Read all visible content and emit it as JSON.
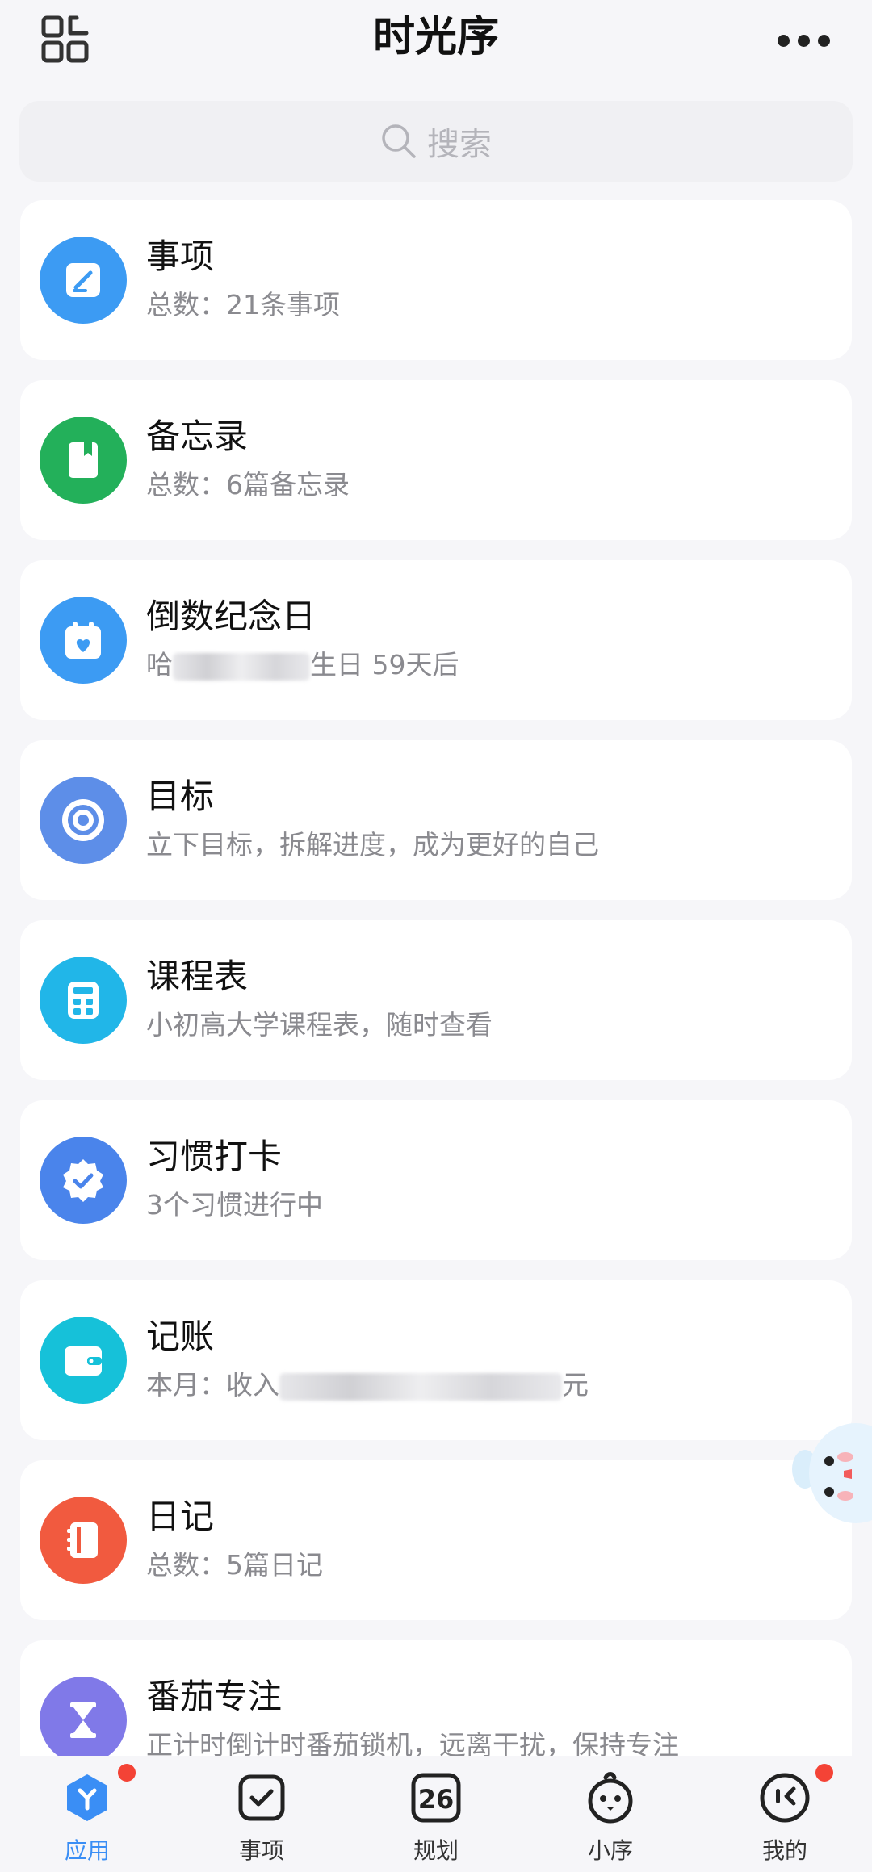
{
  "header": {
    "title": "时光序",
    "scan_icon": "scan-icon",
    "more_icon": "more-icon"
  },
  "search": {
    "placeholder": "搜索"
  },
  "items": [
    {
      "name": "事项",
      "sub": "总数：21条事项",
      "color": "#3c9bf3",
      "icon": "edit-icon"
    },
    {
      "name": "备忘录",
      "sub": "总数：6篇备忘录",
      "color": "#23b05a",
      "icon": "notebook-icon"
    },
    {
      "name": "倒数纪念日",
      "sub_prefix": "哈",
      "sub_suffix": "生日 59天后",
      "color": "#3c9bf3",
      "icon": "calendar-heart-icon"
    },
    {
      "name": "目标",
      "sub": "立下目标，拆解进度，成为更好的自己",
      "color": "#5d8ee8",
      "icon": "target-icon"
    },
    {
      "name": "课程表",
      "sub": "小初高大学课程表，随时查看",
      "color": "#21b6e8",
      "icon": "calculator-icon"
    },
    {
      "name": "习惯打卡",
      "sub": "3个习惯进行中",
      "color": "#4a84eb",
      "icon": "badge-check-icon"
    },
    {
      "name": "记账",
      "sub_prefix": "本月：收入",
      "sub_suffix": "元",
      "color": "#16c1d9",
      "icon": "wallet-icon"
    },
    {
      "name": "日记",
      "sub": "总数：5篇日记",
      "color": "#f15a3f",
      "icon": "diary-icon"
    },
    {
      "name": "番茄专注",
      "sub": "正计时倒计时番茄锁机，远离干扰，保持专注",
      "color": "#8079e8",
      "icon": "hourglass-icon"
    }
  ],
  "tabs": [
    {
      "label": "应用",
      "icon": "apps-icon",
      "active": true,
      "badge": true
    },
    {
      "label": "事项",
      "icon": "check-square-icon",
      "active": false,
      "badge": false
    },
    {
      "label": "规划",
      "icon": "calendar-26-icon",
      "active": false,
      "badge": false,
      "icon_text": "26"
    },
    {
      "label": "小序",
      "icon": "mascot-icon",
      "active": false,
      "badge": false
    },
    {
      "label": "我的",
      "icon": "profile-icon",
      "active": false,
      "badge": true
    }
  ],
  "colors": {
    "accent": "#3a8ef5",
    "badge": "#f44336"
  }
}
